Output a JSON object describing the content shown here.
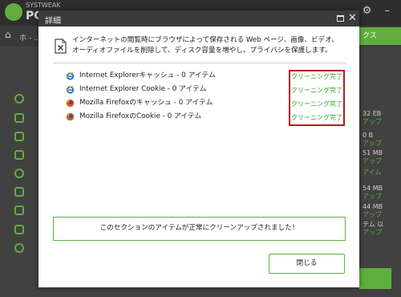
{
  "background_app": {
    "logo_small": "SYSTWEAK",
    "logo_big": "PC",
    "breadcrumb": "ホ - ..",
    "right_tab": "クス",
    "right_values": [
      "32 EB",
      "アップ",
      "0 B",
      "アップ",
      "51 MB",
      "アップ",
      "アイム",
      "54 MB",
      "アップ",
      "44 MB",
      "アップ",
      "テム 以",
      "アップ"
    ]
  },
  "dialog": {
    "title": "詳細",
    "description": "インターネットの閲覧時にブラウザによって保存される Web ページ、画像、ビデオ、オーディオファイルを削除して、ディスク容量を増やし、プライバシを保護します。",
    "items": [
      {
        "icon": "internet-explorer-icon",
        "label": "Internet Explorerキャッシュ - 0 アイテム",
        "status": "クリーニング完了"
      },
      {
        "icon": "internet-explorer-icon",
        "label": "Internet Explorer Cookie - 0 アイテム",
        "status": "クリーニング完了"
      },
      {
        "icon": "firefox-icon",
        "label": "Mozilla Firefoxのキャッシュ - 0 アイテム",
        "status": "クリーニング完了"
      },
      {
        "icon": "firefox-icon",
        "label": "Mozilla FirefoxのCookie - 0 アイテム",
        "status": "クリーニング完了"
      }
    ],
    "result_message": "このセクションのアイテムが正常にクリーンアップされました！",
    "close_button": "閉じる"
  },
  "colors": {
    "accent_green": "#5fae3e",
    "status_green": "#3c9e2a",
    "highlight_red": "#b01c1c",
    "titlebar_dark": "#3a3a3a"
  }
}
